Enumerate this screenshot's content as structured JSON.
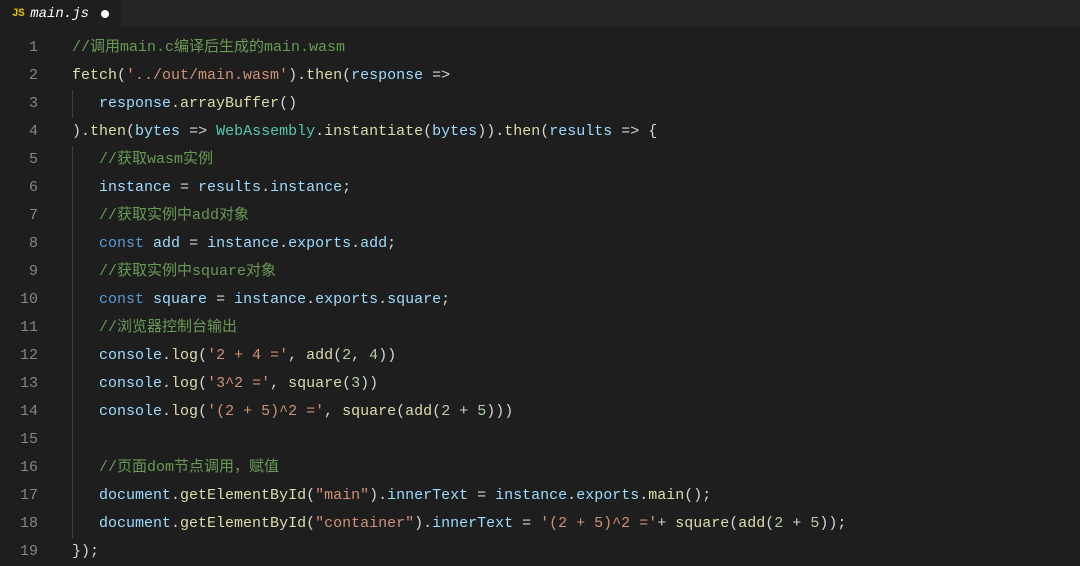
{
  "tab": {
    "icon_label": "JS",
    "filename": "main.js",
    "modified": true
  },
  "lines": {
    "count": 19,
    "l1": {
      "indent": 0,
      "tokens": [
        {
          "t": "//调用main.c编译后生成的main.wasm",
          "c": "comment"
        }
      ]
    },
    "l2": {
      "indent": 0,
      "tokens": [
        {
          "t": "fetch",
          "c": "func"
        },
        {
          "t": "(",
          "c": "op"
        },
        {
          "t": "'../out/main.wasm'",
          "c": "string"
        },
        {
          "t": ").",
          "c": "op"
        },
        {
          "t": "then",
          "c": "func"
        },
        {
          "t": "(",
          "c": "op"
        },
        {
          "t": "response",
          "c": "var"
        },
        {
          "t": " => ",
          "c": "plain"
        }
      ]
    },
    "l3": {
      "indent": 1,
      "tokens": [
        {
          "t": "response",
          "c": "var"
        },
        {
          "t": ".",
          "c": "op"
        },
        {
          "t": "arrayBuffer",
          "c": "func"
        },
        {
          "t": "()",
          "c": "op"
        }
      ]
    },
    "l4": {
      "indent": 0,
      "tokens": [
        {
          "t": ").",
          "c": "op"
        },
        {
          "t": "then",
          "c": "func"
        },
        {
          "t": "(",
          "c": "op"
        },
        {
          "t": "bytes",
          "c": "var"
        },
        {
          "t": " => ",
          "c": "plain"
        },
        {
          "t": "WebAssembly",
          "c": "class"
        },
        {
          "t": ".",
          "c": "op"
        },
        {
          "t": "instantiate",
          "c": "func"
        },
        {
          "t": "(",
          "c": "op"
        },
        {
          "t": "bytes",
          "c": "var"
        },
        {
          "t": ")).",
          "c": "op"
        },
        {
          "t": "then",
          "c": "func"
        },
        {
          "t": "(",
          "c": "op"
        },
        {
          "t": "results",
          "c": "var"
        },
        {
          "t": " => {",
          "c": "plain"
        }
      ]
    },
    "l5": {
      "indent": 1,
      "tokens": [
        {
          "t": "//获取wasm实例",
          "c": "comment"
        }
      ]
    },
    "l6": {
      "indent": 1,
      "tokens": [
        {
          "t": "instance",
          "c": "var"
        },
        {
          "t": " = ",
          "c": "plain"
        },
        {
          "t": "results",
          "c": "var"
        },
        {
          "t": ".",
          "c": "op"
        },
        {
          "t": "instance",
          "c": "var"
        },
        {
          "t": ";",
          "c": "op"
        }
      ]
    },
    "l7": {
      "indent": 1,
      "tokens": [
        {
          "t": "//获取实例中add对象",
          "c": "comment"
        }
      ]
    },
    "l8": {
      "indent": 1,
      "tokens": [
        {
          "t": "const",
          "c": "keyword"
        },
        {
          "t": " ",
          "c": "plain"
        },
        {
          "t": "add",
          "c": "var"
        },
        {
          "t": " = ",
          "c": "plain"
        },
        {
          "t": "instance",
          "c": "var"
        },
        {
          "t": ".",
          "c": "op"
        },
        {
          "t": "exports",
          "c": "var"
        },
        {
          "t": ".",
          "c": "op"
        },
        {
          "t": "add",
          "c": "var"
        },
        {
          "t": ";",
          "c": "op"
        }
      ]
    },
    "l9": {
      "indent": 1,
      "tokens": [
        {
          "t": "//获取实例中square对象",
          "c": "comment"
        }
      ]
    },
    "l10": {
      "indent": 1,
      "tokens": [
        {
          "t": "const",
          "c": "keyword"
        },
        {
          "t": " ",
          "c": "plain"
        },
        {
          "t": "square",
          "c": "var"
        },
        {
          "t": " = ",
          "c": "plain"
        },
        {
          "t": "instance",
          "c": "var"
        },
        {
          "t": ".",
          "c": "op"
        },
        {
          "t": "exports",
          "c": "var"
        },
        {
          "t": ".",
          "c": "op"
        },
        {
          "t": "square",
          "c": "var"
        },
        {
          "t": ";",
          "c": "op"
        }
      ]
    },
    "l11": {
      "indent": 1,
      "tokens": [
        {
          "t": "//浏览器控制台输出",
          "c": "comment"
        }
      ]
    },
    "l12": {
      "indent": 1,
      "tokens": [
        {
          "t": "console",
          "c": "var"
        },
        {
          "t": ".",
          "c": "op"
        },
        {
          "t": "log",
          "c": "func"
        },
        {
          "t": "(",
          "c": "op"
        },
        {
          "t": "'2 + 4 ='",
          "c": "string"
        },
        {
          "t": ", ",
          "c": "plain"
        },
        {
          "t": "add",
          "c": "func"
        },
        {
          "t": "(",
          "c": "op"
        },
        {
          "t": "2",
          "c": "number"
        },
        {
          "t": ", ",
          "c": "plain"
        },
        {
          "t": "4",
          "c": "number"
        },
        {
          "t": "))",
          "c": "op"
        }
      ]
    },
    "l13": {
      "indent": 1,
      "tokens": [
        {
          "t": "console",
          "c": "var"
        },
        {
          "t": ".",
          "c": "op"
        },
        {
          "t": "log",
          "c": "func"
        },
        {
          "t": "(",
          "c": "op"
        },
        {
          "t": "'3^2 ='",
          "c": "string"
        },
        {
          "t": ", ",
          "c": "plain"
        },
        {
          "t": "square",
          "c": "func"
        },
        {
          "t": "(",
          "c": "op"
        },
        {
          "t": "3",
          "c": "number"
        },
        {
          "t": "))",
          "c": "op"
        }
      ]
    },
    "l14": {
      "indent": 1,
      "tokens": [
        {
          "t": "console",
          "c": "var"
        },
        {
          "t": ".",
          "c": "op"
        },
        {
          "t": "log",
          "c": "func"
        },
        {
          "t": "(",
          "c": "op"
        },
        {
          "t": "'(2 + 5)^2 ='",
          "c": "string"
        },
        {
          "t": ", ",
          "c": "plain"
        },
        {
          "t": "square",
          "c": "func"
        },
        {
          "t": "(",
          "c": "op"
        },
        {
          "t": "add",
          "c": "func"
        },
        {
          "t": "(",
          "c": "op"
        },
        {
          "t": "2",
          "c": "number"
        },
        {
          "t": " + ",
          "c": "plain"
        },
        {
          "t": "5",
          "c": "number"
        },
        {
          "t": ")))",
          "c": "op"
        }
      ]
    },
    "l15": {
      "indent": 1,
      "tokens": []
    },
    "l16": {
      "indent": 1,
      "tokens": [
        {
          "t": "//页面dom节点调用，赋值",
          "c": "comment"
        }
      ]
    },
    "l17": {
      "indent": 1,
      "tokens": [
        {
          "t": "document",
          "c": "var"
        },
        {
          "t": ".",
          "c": "op"
        },
        {
          "t": "getElementById",
          "c": "func"
        },
        {
          "t": "(",
          "c": "op"
        },
        {
          "t": "\"main\"",
          "c": "string"
        },
        {
          "t": ").",
          "c": "op"
        },
        {
          "t": "innerText",
          "c": "var"
        },
        {
          "t": " = ",
          "c": "plain"
        },
        {
          "t": "instance",
          "c": "var"
        },
        {
          "t": ".",
          "c": "op"
        },
        {
          "t": "exports",
          "c": "var"
        },
        {
          "t": ".",
          "c": "op"
        },
        {
          "t": "main",
          "c": "func"
        },
        {
          "t": "();",
          "c": "op"
        }
      ]
    },
    "l18": {
      "indent": 1,
      "tokens": [
        {
          "t": "document",
          "c": "var"
        },
        {
          "t": ".",
          "c": "op"
        },
        {
          "t": "getElementById",
          "c": "func"
        },
        {
          "t": "(",
          "c": "op"
        },
        {
          "t": "\"container\"",
          "c": "string"
        },
        {
          "t": ").",
          "c": "op"
        },
        {
          "t": "innerText",
          "c": "var"
        },
        {
          "t": " = ",
          "c": "plain"
        },
        {
          "t": "'(2 + 5)^2 ='",
          "c": "string"
        },
        {
          "t": "+ ",
          "c": "plain"
        },
        {
          "t": "square",
          "c": "func"
        },
        {
          "t": "(",
          "c": "op"
        },
        {
          "t": "add",
          "c": "func"
        },
        {
          "t": "(",
          "c": "op"
        },
        {
          "t": "2",
          "c": "number"
        },
        {
          "t": " + ",
          "c": "plain"
        },
        {
          "t": "5",
          "c": "number"
        },
        {
          "t": "));",
          "c": "op"
        }
      ]
    },
    "l19": {
      "indent": 0,
      "tokens": [
        {
          "t": "});",
          "c": "op"
        }
      ]
    }
  }
}
